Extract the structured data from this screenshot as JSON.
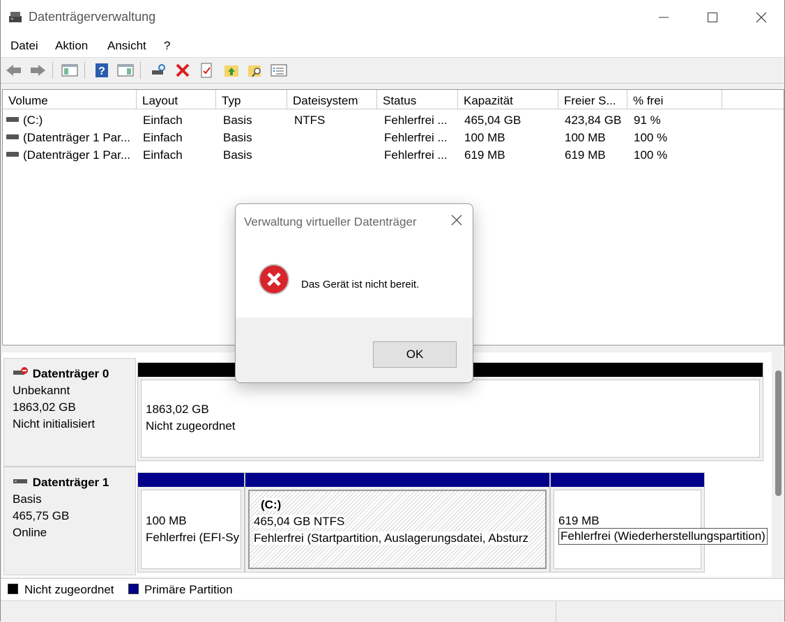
{
  "window": {
    "title": "Datenträgerverwaltung",
    "minimize_icon": "minimize-icon",
    "maximize_icon": "maximize-icon",
    "close_icon": "close-icon"
  },
  "menu": [
    "Datei",
    "Aktion",
    "Ansicht",
    "?"
  ],
  "toolbar": {
    "icons": [
      "back-arrow-icon",
      "forward-arrow-icon",
      "console-tree-icon",
      "help-icon",
      "action-pane-icon",
      "connect-disk-icon",
      "delete-icon",
      "properties-icon",
      "open-folder-icon",
      "explore-icon",
      "checklist-icon"
    ]
  },
  "volumes": {
    "columns": [
      "Volume",
      "Layout",
      "Typ",
      "Dateisystem",
      "Status",
      "Kapazität",
      "Freier S...",
      "% frei"
    ],
    "rows": [
      {
        "volume": "(C:)",
        "layout": "Einfach",
        "typ": "Basis",
        "fs": "NTFS",
        "status": "Fehlerfrei ...",
        "kap": "465,04 GB",
        "frei": "423,84 GB",
        "pct": "91 %"
      },
      {
        "volume": "(Datenträger 1 Par...",
        "layout": "Einfach",
        "typ": "Basis",
        "fs": "",
        "status": "Fehlerfrei ...",
        "kap": "100 MB",
        "frei": "100 MB",
        "pct": "100 %"
      },
      {
        "volume": "(Datenträger 1 Par...",
        "layout": "Einfach",
        "typ": "Basis",
        "fs": "",
        "status": "Fehlerfrei ...",
        "kap": "619 MB",
        "frei": "619 MB",
        "pct": "100 %"
      }
    ]
  },
  "disks": [
    {
      "name": "Datenträger 0",
      "type": "Unbekannt",
      "size": "1863,02 GB",
      "state": "Nicht initialisiert",
      "partitions": [
        {
          "line1": "1863,02 GB",
          "line2": "Nicht zugeordnet"
        }
      ]
    },
    {
      "name": "Datenträger 1",
      "type": "Basis",
      "size": "465,75 GB",
      "state": "Online",
      "partitions": [
        {
          "line1": "100 MB",
          "line2": "Fehlerfrei (EFI-Sy"
        },
        {
          "label": "(C:)",
          "line1": "465,04 GB NTFS",
          "line2": "Fehlerfrei (Startpartition, Auslagerungsdatei, Absturz"
        },
        {
          "line1": "619 MB",
          "line2": "Fehlerfrei (Wiederherstellungspartition)"
        }
      ]
    }
  ],
  "legend": [
    {
      "label": "Nicht zugeordnet",
      "color": "#000000"
    },
    {
      "label": "Primäre Partition",
      "color": "#00008b"
    }
  ],
  "dialog": {
    "title": "Verwaltung virtueller Datenträger",
    "message": "Das Gerät ist nicht bereit.",
    "ok_label": "OK",
    "icon": "error-icon"
  },
  "colors": {
    "unallocated": "#000000",
    "primary": "#00008b",
    "error": "#d8242b"
  }
}
